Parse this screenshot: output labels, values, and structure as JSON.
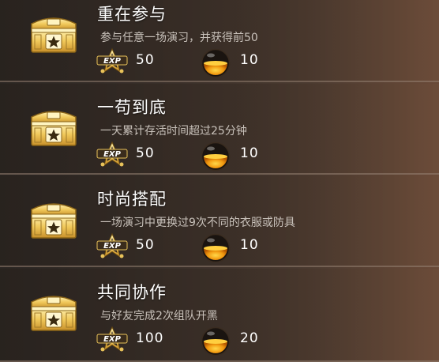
{
  "tasks": [
    {
      "title": "重在参与",
      "description": "参与任意一场演习，并获得前50",
      "exp": "50",
      "coins": "10"
    },
    {
      "title": "一苟到底",
      "description": "一天累计存活时间超过25分钟",
      "exp": "50",
      "coins": "10"
    },
    {
      "title": "时尚搭配",
      "description": "一场演习中更换过9次不同的衣服或防具",
      "exp": "50",
      "coins": "10"
    },
    {
      "title": "共同协作",
      "description": "与好友完成2次组队开黑",
      "exp": "100",
      "coins": "20"
    }
  ],
  "icons": {
    "chest": "treasure-chest-icon",
    "exp": "exp-badge-icon",
    "coin": "orange-coin-icon"
  },
  "exp_badge_text": "EXP",
  "colors": {
    "gold": "#e8c25a",
    "coin_orange": "#f0a010"
  }
}
